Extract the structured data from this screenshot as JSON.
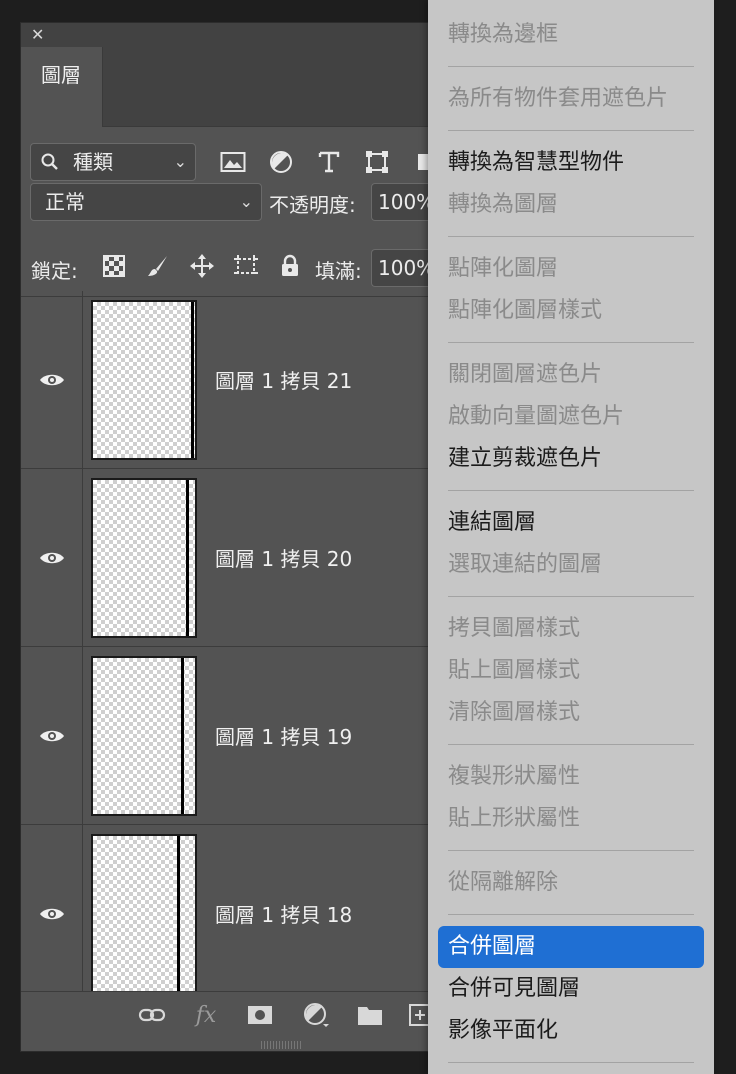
{
  "panel": {
    "tab_label": "圖層",
    "kind_filter": "種類",
    "blend_mode": "正常",
    "opacity_label": "不透明度:",
    "opacity_value": "100%",
    "lock_label": "鎖定:",
    "fill_label": "填滿:",
    "fill_value": "100%",
    "layers": [
      {
        "name": "圖層 1 拷貝 21"
      },
      {
        "name": "圖層 1 拷貝 20"
      },
      {
        "name": "圖層 1 拷貝 19"
      },
      {
        "name": "圖層 1 拷貝 18"
      }
    ],
    "bottom_fx_label": "fx"
  },
  "menu": {
    "items": [
      {
        "label": "轉換為邊框",
        "enabled": false
      },
      {
        "label": "為所有物件套用遮色片",
        "enabled": false
      },
      {
        "label": "轉換為智慧型物件",
        "enabled": true
      },
      {
        "label": "轉換為圖層",
        "enabled": false
      },
      {
        "label": "點陣化圖層",
        "enabled": false
      },
      {
        "label": "點陣化圖層樣式",
        "enabled": false
      },
      {
        "label": "關閉圖層遮色片",
        "enabled": false
      },
      {
        "label": "啟動向量圖遮色片",
        "enabled": false
      },
      {
        "label": "建立剪裁遮色片",
        "enabled": true
      },
      {
        "label": "連結圖層",
        "enabled": true
      },
      {
        "label": "選取連結的圖層",
        "enabled": false
      },
      {
        "label": "拷貝圖層樣式",
        "enabled": false
      },
      {
        "label": "貼上圖層樣式",
        "enabled": false
      },
      {
        "label": "清除圖層樣式",
        "enabled": false
      },
      {
        "label": "複製形狀屬性",
        "enabled": false
      },
      {
        "label": "貼上形狀屬性",
        "enabled": false
      },
      {
        "label": "從隔離解除",
        "enabled": false
      },
      {
        "label": "合併圖層",
        "enabled": true,
        "highlighted": true
      },
      {
        "label": "合併可見圖層",
        "enabled": true
      },
      {
        "label": "影像平面化",
        "enabled": true
      }
    ]
  },
  "colors": {
    "highlight": "#1f6fd3",
    "menu_bg": "#c6c6c6",
    "panel_bg": "#535353"
  }
}
